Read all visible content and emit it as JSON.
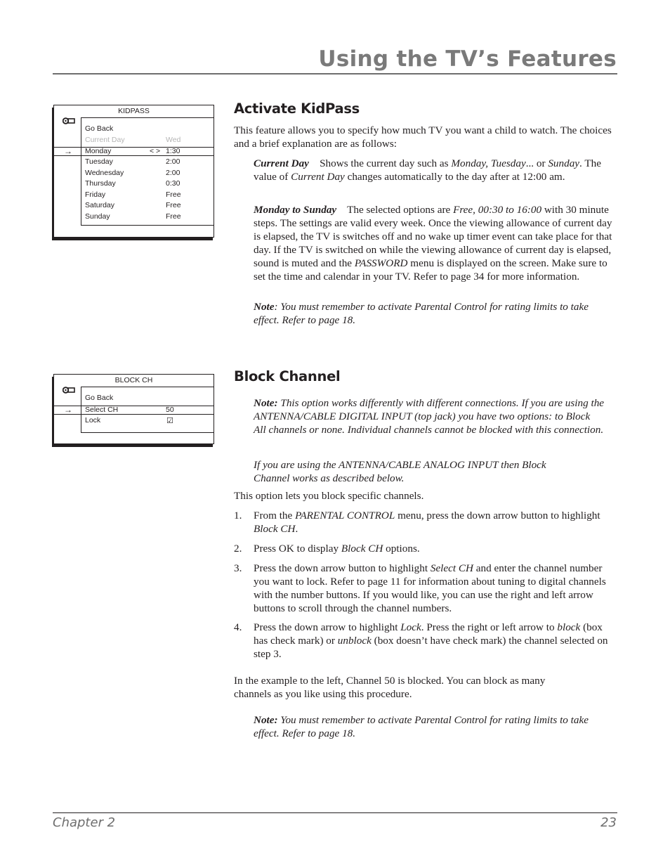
{
  "header": {
    "title": "Using the TV’s Features"
  },
  "kidpass_menu": {
    "title": "KIDPASS",
    "icon": "key-icon",
    "go_back": "Go Back",
    "current_day": {
      "label": "Current Day",
      "value": "Wed"
    },
    "selected_arrow": "→",
    "lr_arrows": "< >",
    "days": [
      {
        "label": "Monday",
        "value": "1:30"
      },
      {
        "label": "Tuesday",
        "value": "2:00"
      },
      {
        "label": "Wednesday",
        "value": "2:00"
      },
      {
        "label": "Thursday",
        "value": "0:30"
      },
      {
        "label": "Friday",
        "value": "Free"
      },
      {
        "label": "Saturday",
        "value": "Free"
      },
      {
        "label": "Sunday",
        "value": "Free"
      }
    ]
  },
  "blockch_menu": {
    "title": "BLOCK CH",
    "icon": "key-icon",
    "go_back": "Go Back",
    "selected_arrow": "→",
    "select_ch": {
      "label": "Select CH",
      "value": "50"
    },
    "lock": {
      "label": "Lock",
      "checked": true,
      "glyph": "☑"
    }
  },
  "kidpass": {
    "heading": "Activate KidPass",
    "intro": "This feature allows you to specify how much TV you want a child to watch. The choices and a brief explanation are as follows:",
    "current_day_term": "Current Day",
    "current_day_desc_1": "Shows the current day such as ",
    "current_day_desc_i1": "Monday, Tuesday",
    "current_day_desc_2": "... or ",
    "current_day_desc_i2": "Sunday",
    "current_day_desc_3": ". The value of ",
    "current_day_desc_i3": "Current Day",
    "current_day_desc_4": " changes automatically to the day after at 12:00 am.",
    "mon_sun_term": "Monday to Sunday",
    "mon_sun_desc_1": "The selected options are ",
    "mon_sun_desc_i1": "Free, 00:30 to 16:00",
    "mon_sun_desc_2": " with 30 minute steps. The settings are valid every week. Once the viewing allowance of current day is elapsed, the TV is switches off and no wake up timer event can take place for that day. If the TV is switched on while the viewing allowance of current day is elapsed, sound is muted and the ",
    "mon_sun_desc_i2": "PASSWORD",
    "mon_sun_desc_3": " menu is displayed on the screen. Make sure to set the time and calendar in your TV. Refer to page 34 for more information.",
    "note_label": "Note",
    "note_text": ": You must remember to activate Parental Control for rating limits to take effect. Refer to page 18."
  },
  "blockch": {
    "heading": "Block Channel",
    "note1_label": "Note:",
    "note1_text": " This option works differently with different connections. If you are using the ANTENNA/CABLE DIGITAL INPUT (top jack) you have two options: to Block All channels or none. Individual channels cannot  be blocked with this connection.",
    "note2_text": "If you are using the ANTENNA/CABLE ANALOG INPUT then Block Channel works as described below.",
    "intro": "This option lets you block specific channels.",
    "steps": [
      {
        "num": "1.",
        "t1": "From the ",
        "i1": "PARENTAL CONTROL",
        "t2": " menu, press the down arrow button to highlight ",
        "i2": "Block CH",
        "t3": "."
      },
      {
        "num": "2.",
        "t1": "Press OK to display ",
        "i1": "Block CH",
        "t2": " options.",
        "i2": "",
        "t3": ""
      },
      {
        "num": "3.",
        "t1": "Press the down arrow button to highlight ",
        "i1": "Select CH",
        "t2": " and enter the channel number you want to lock. Refer to page 11 for information about tuning to digital channels with the number buttons. If you would like, you can use the right and left arrow buttons to scroll through the channel numbers.",
        "i2": "",
        "t3": ""
      },
      {
        "num": "4.",
        "t1": "Press the down arrow to highlight ",
        "i1": "Lock",
        "t2": ". Press the right or left arrow to ",
        "i2": "block",
        "t3": " (box has check mark) or ",
        "i3": "unblock",
        "t4": " (box doesn’t have check mark) the channel selected on step 3."
      }
    ],
    "example": "In the example to the left, Channel 50 is blocked. You can block as many channels as you like using this procedure.",
    "note3_label": "Note:",
    "note3_text": " You must remember to activate Parental Control for rating limits to take effect. Refer to page 18."
  },
  "footer": {
    "chapter": "Chapter 2",
    "page": "23"
  }
}
